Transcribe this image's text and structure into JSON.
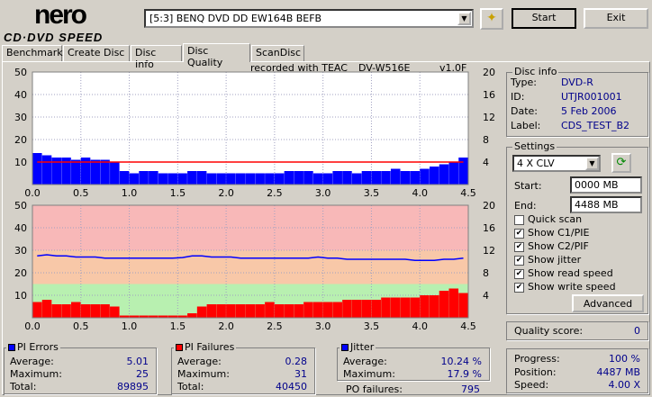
{
  "app": {
    "logo_top": "nero",
    "logo_bottom": "CD·DVD SPEED"
  },
  "toolbar": {
    "drive": "[5:3]  BENQ DVD DD EW164B BEFB",
    "start": "Start",
    "exit": "Exit"
  },
  "tabs": [
    "Benchmark",
    "Create Disc",
    "Disc Info",
    "Disc Quality",
    "ScanDisc"
  ],
  "recorded": {
    "label": "recorded with TEAC",
    "model": "DV-W516E",
    "version": "v1.0F"
  },
  "disc_info": {
    "title": "Disc info",
    "type_label": "Type:",
    "type": "DVD-R",
    "id_label": "ID:",
    "id": "UTJR001001",
    "date_label": "Date:",
    "date": "5 Feb 2006",
    "label_label": "Label:",
    "label": "CDS_TEST_B2"
  },
  "settings": {
    "title": "Settings",
    "speed": "4 X CLV",
    "start_label": "Start:",
    "start": "0000 MB",
    "end_label": "End:",
    "end": "4488 MB",
    "checks": [
      {
        "label": "Quick scan",
        "checked": false
      },
      {
        "label": "Show C1/PIE",
        "checked": true
      },
      {
        "label": "Show C2/PIF",
        "checked": true
      },
      {
        "label": "Show jitter",
        "checked": true
      },
      {
        "label": "Show read speed",
        "checked": true
      },
      {
        "label": "Show write speed",
        "checked": true
      }
    ],
    "advanced": "Advanced"
  },
  "quality": {
    "label": "Quality score:",
    "value": "0"
  },
  "progress": {
    "progress_label": "Progress:",
    "progress": "100 %",
    "position_label": "Position:",
    "position": "4487 MB",
    "speed_label": "Speed:",
    "speed": "4.00 X"
  },
  "pi_errors": {
    "title": "PI Errors",
    "avg_label": "Average:",
    "avg": "5.01",
    "max_label": "Maximum:",
    "max": "25",
    "total_label": "Total:",
    "total": "89895"
  },
  "pi_failures": {
    "title": "PI Failures",
    "avg_label": "Average:",
    "avg": "0.28",
    "max_label": "Maximum:",
    "max": "31",
    "total_label": "Total:",
    "total": "40450"
  },
  "jitter": {
    "title": "Jitter",
    "avg_label": "Average:",
    "avg": "10.24 %",
    "max_label": "Maximum:",
    "max": "17.9 %",
    "po_label": "PO failures:",
    "po": "795"
  },
  "colors": {
    "pie": "#0000ff",
    "pif": "#ff0000",
    "jitter": "#0000ff",
    "speed": "#ff0000"
  },
  "chart_data": [
    {
      "type": "bar",
      "title": "PI Errors / Read speed",
      "x_ticks": [
        "0.0",
        "0.5",
        "1.0",
        "1.5",
        "2.0",
        "2.5",
        "3.0",
        "3.5",
        "4.0",
        "4.5"
      ],
      "xlim": [
        0,
        4.5
      ],
      "ylim": [
        0,
        50
      ],
      "y_ticks": [
        "50",
        "40",
        "30",
        "20",
        "10"
      ],
      "y2lim": [
        0,
        20
      ],
      "y2_ticks": [
        "20",
        "16",
        "12",
        "8",
        "4"
      ],
      "x": [
        0,
        0.1,
        0.2,
        0.3,
        0.4,
        0.5,
        0.6,
        0.7,
        0.8,
        0.9,
        1.0,
        1.1,
        1.2,
        1.3,
        1.4,
        1.5,
        1.6,
        1.7,
        1.8,
        1.9,
        2.0,
        2.1,
        2.2,
        2.3,
        2.4,
        2.5,
        2.6,
        2.7,
        2.8,
        2.9,
        3.0,
        3.1,
        3.2,
        3.3,
        3.4,
        3.5,
        3.6,
        3.7,
        3.8,
        3.9,
        4.0,
        4.1,
        4.2,
        4.3,
        4.4
      ],
      "series": [
        {
          "name": "PI Errors",
          "values": [
            14,
            13,
            12,
            12,
            11,
            12,
            11,
            11,
            10,
            6,
            5,
            6,
            6,
            5,
            5,
            5,
            6,
            6,
            5,
            5,
            5,
            5,
            5,
            5,
            5,
            5,
            6,
            6,
            6,
            5,
            5,
            6,
            6,
            5,
            6,
            6,
            6,
            7,
            6,
            6,
            7,
            8,
            9,
            10,
            12
          ]
        },
        {
          "name": "Read speed",
          "axis": "right",
          "values": [
            4,
            4,
            4,
            4,
            4,
            4,
            4,
            4,
            4,
            4,
            4,
            4,
            4,
            4,
            4,
            4,
            4,
            4,
            4,
            4,
            4,
            4,
            4,
            4,
            4,
            4,
            4,
            4,
            4,
            4,
            4,
            4,
            4,
            4,
            4,
            4,
            4,
            4,
            4,
            4,
            4,
            4,
            4,
            4,
            4
          ]
        }
      ]
    },
    {
      "type": "bar",
      "title": "PI Failures / Jitter",
      "x_ticks": [
        "0.0",
        "0.5",
        "1.0",
        "1.5",
        "2.0",
        "2.5",
        "3.0",
        "3.5",
        "4.0",
        "4.5"
      ],
      "xlim": [
        0,
        4.5
      ],
      "ylim": [
        0,
        50
      ],
      "y_ticks": [
        "50",
        "40",
        "30",
        "20",
        "10"
      ],
      "y2lim": [
        0,
        20
      ],
      "y2_ticks": [
        "20",
        "16",
        "12",
        "8",
        "4"
      ],
      "x": [
        0,
        0.1,
        0.2,
        0.3,
        0.4,
        0.5,
        0.6,
        0.7,
        0.8,
        0.9,
        1.0,
        1.1,
        1.2,
        1.3,
        1.4,
        1.5,
        1.6,
        1.7,
        1.8,
        1.9,
        2.0,
        2.1,
        2.2,
        2.3,
        2.4,
        2.5,
        2.6,
        2.7,
        2.8,
        2.9,
        3.0,
        3.1,
        3.2,
        3.3,
        3.4,
        3.5,
        3.6,
        3.7,
        3.8,
        3.9,
        4.0,
        4.1,
        4.2,
        4.3,
        4.4
      ],
      "bands": [
        {
          "to": 6,
          "color": "#b8f0b0"
        },
        {
          "to": 12,
          "color": "#f8c8a8"
        },
        {
          "to": 20,
          "color": "#f8b8b8"
        }
      ],
      "series": [
        {
          "name": "PI Failures",
          "values": [
            7,
            8,
            6,
            6,
            7,
            6,
            6,
            6,
            5,
            1,
            1,
            1,
            1,
            1,
            1,
            1,
            2,
            5,
            6,
            6,
            6,
            6,
            6,
            6,
            7,
            6,
            6,
            6,
            7,
            7,
            7,
            7,
            8,
            8,
            8,
            8,
            9,
            9,
            9,
            9,
            10,
            10,
            12,
            13,
            11
          ]
        },
        {
          "name": "Jitter",
          "axis": "right",
          "values": [
            11,
            11.2,
            11,
            11,
            10.8,
            10.8,
            10.8,
            10.6,
            10.6,
            10.6,
            10.6,
            10.6,
            10.6,
            10.6,
            10.6,
            10.7,
            11,
            11,
            10.8,
            10.8,
            10.8,
            10.6,
            10.6,
            10.6,
            10.6,
            10.6,
            10.6,
            10.6,
            10.6,
            10.8,
            10.6,
            10.6,
            10.4,
            10.4,
            10.4,
            10.4,
            10.4,
            10.4,
            10.4,
            10.2,
            10.2,
            10.2,
            10.4,
            10.4,
            10.6
          ]
        }
      ]
    }
  ]
}
